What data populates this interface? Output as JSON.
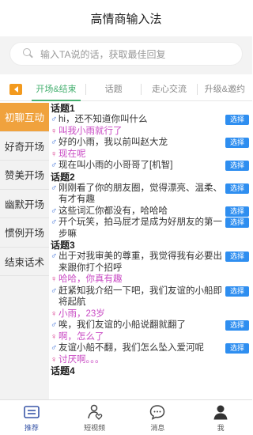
{
  "header": {
    "title": "高情商输入法"
  },
  "search": {
    "placeholder": "输入TA说的话，获取最佳回复"
  },
  "tabs": [
    {
      "label": "开场&结束"
    },
    {
      "label": "话题"
    },
    {
      "label": "走心交流"
    },
    {
      "label": "升级&邀约"
    }
  ],
  "sidebar": {
    "items": [
      {
        "label": "初聊互动"
      },
      {
        "label": "好奇开场"
      },
      {
        "label": "赞美开场"
      },
      {
        "label": "幽默开场"
      },
      {
        "label": "惯例开场"
      },
      {
        "label": "结束话术"
      }
    ]
  },
  "select_label": "选择",
  "topics": [
    {
      "title": "话题1",
      "lines": [
        {
          "gender": "♂",
          "text": "hi，还不知道你叫什么"
        },
        {
          "gender": "♀",
          "text": "叫我小雨就行了"
        },
        {
          "gender": "♂",
          "text": "好的小雨，我以前叫赵大龙"
        },
        {
          "gender": "♀",
          "text": "现在呢"
        },
        {
          "gender": "♂",
          "text": "现在叫小雨的小哥哥了[机智]"
        }
      ]
    },
    {
      "title": "话题2",
      "lines": [
        {
          "gender": "♂",
          "text": "刚刚看了你的朋友圈，觉得漂亮、温柔、有才有趣"
        },
        {
          "gender": "♂",
          "text": "这些词汇你都没有，哈哈哈"
        },
        {
          "gender": "♂",
          "text": "开个玩笑，拍马屁才是成为好朋友的第一步嘛"
        }
      ]
    },
    {
      "title": "话题3",
      "lines": [
        {
          "gender": "♂",
          "text": "出于对我审美的尊重，我觉得我有必要出来跟你打个招呼"
        },
        {
          "gender": "♀",
          "text": "哈哈，你真有趣"
        },
        {
          "gender": "♂",
          "text": "赶紧知我介绍一下吧，我们友谊的小船即将起航"
        },
        {
          "gender": "♀",
          "text": "小雨，23岁"
        },
        {
          "gender": "♂",
          "text": "唉，我们友谊的小船说翻就翻了"
        },
        {
          "gender": "♀",
          "text": "啊，怎么了"
        },
        {
          "gender": "♂",
          "text": "友谊小船不翻，我们怎么坠入爱河呢"
        },
        {
          "gender": "♀",
          "text": "讨厌啊。。。"
        }
      ]
    },
    {
      "title": "话题4",
      "lines": []
    }
  ],
  "bottom_nav": [
    {
      "label": "推荐",
      "icon": "list-card-icon"
    },
    {
      "label": "短视频",
      "icon": "heart-person-icon"
    },
    {
      "label": "消息",
      "icon": "chat-bubble-icon"
    },
    {
      "label": "我",
      "icon": "user-icon"
    }
  ],
  "colors": {
    "accent_orange": "#f0a23d",
    "tab_green": "#46b070",
    "button_blue": "#2e8ef0",
    "female_pink": "#c94bc4",
    "male_blue": "#3b6fd8",
    "nav_active": "#3a57a8"
  }
}
